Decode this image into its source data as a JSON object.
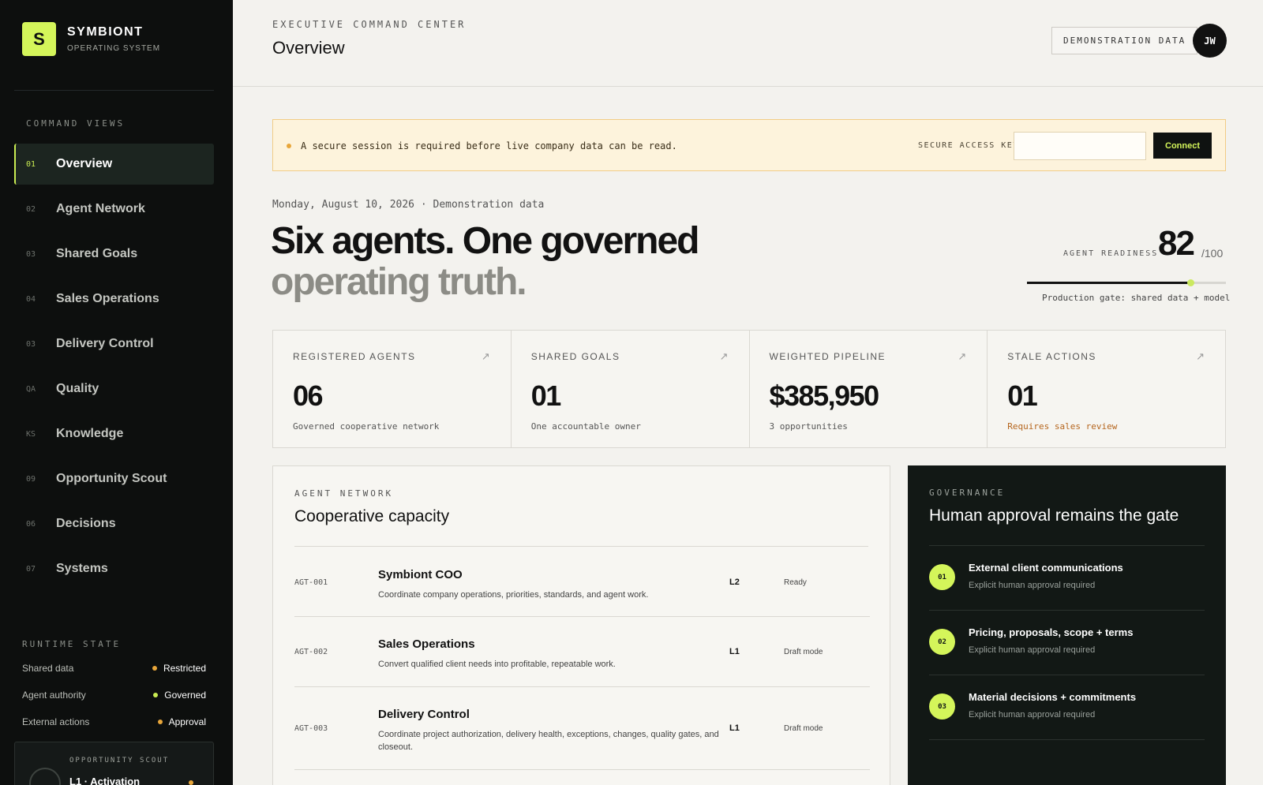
{
  "brand": {
    "logo_letter": "S",
    "name": "SYMBIONT",
    "subtitle": "OPERATING SYSTEM"
  },
  "sidebar": {
    "section_label": "COMMAND VIEWS",
    "items": [
      {
        "num": "01",
        "label": "Overview",
        "active": true
      },
      {
        "num": "02",
        "label": "Agent Network"
      },
      {
        "num": "03",
        "label": "Shared Goals"
      },
      {
        "num": "04",
        "label": "Sales Operations"
      },
      {
        "num": "03",
        "label": "Delivery Control"
      },
      {
        "num": "QA",
        "label": "Quality"
      },
      {
        "num": "KS",
        "label": "Knowledge"
      },
      {
        "num": "09",
        "label": "Opportunity Scout"
      },
      {
        "num": "06",
        "label": "Decisions"
      },
      {
        "num": "07",
        "label": "Systems"
      }
    ],
    "runtime_label": "RUNTIME STATE",
    "runtime": [
      {
        "label": "Shared data",
        "value": "Restricted",
        "color": "#e8a63a"
      },
      {
        "label": "Agent authority",
        "value": "Governed",
        "color": "#c9ec52"
      },
      {
        "label": "External actions",
        "value": "Approval",
        "color": "#e8a63a"
      }
    ],
    "scout": {
      "label": "OPPORTUNITY SCOUT",
      "title": "L1 · Activation"
    }
  },
  "header": {
    "eyebrow": "EXECUTIVE COMMAND CENTER",
    "title": "Overview",
    "demo_button": "DEMONSTRATION DATA",
    "avatar_initials": "JW"
  },
  "alert": {
    "message": "A secure session is required before live company data can be read.",
    "key_label": "SECURE ACCESS KEY",
    "key_value": "",
    "connect_label": "Connect"
  },
  "hero": {
    "dateline": "Monday, August 10, 2026 · Demonstration data",
    "line1": "Six agents. One governed",
    "line2": "operating truth.",
    "readiness_label": "AGENT READINESS",
    "readiness_score": "82",
    "readiness_max": "/100",
    "readiness_fraction": 0.82,
    "readiness_note": "Production gate: shared data + model"
  },
  "stats": [
    {
      "label": "REGISTERED AGENTS",
      "value": "06",
      "note": "Governed cooperative network",
      "warn": false
    },
    {
      "label": "SHARED GOALS",
      "value": "01",
      "note": "One accountable owner",
      "warn": false
    },
    {
      "label": "WEIGHTED PIPELINE",
      "value": "$385,950",
      "note": "3 opportunities",
      "warn": false
    },
    {
      "label": "STALE ACTIONS",
      "value": "01",
      "note": "Requires sales review",
      "warn": true
    }
  ],
  "agent_network": {
    "eyebrow": "AGENT NETWORK",
    "title": "Cooperative capacity",
    "agents": [
      {
        "id": "AGT-001",
        "name": "Symbiont COO",
        "desc": "Coordinate company operations, priorities, standards, and agent work.",
        "level": "L2",
        "status": "Ready"
      },
      {
        "id": "AGT-002",
        "name": "Sales Operations",
        "desc": "Convert qualified client needs into profitable, repeatable work.",
        "level": "L1",
        "status": "Draft mode"
      },
      {
        "id": "AGT-003",
        "name": "Delivery Control",
        "desc": "Coordinate project authorization, delivery health, exceptions, changes, quality gates, and closeout.",
        "level": "L1",
        "status": "Draft mode"
      }
    ]
  },
  "governance": {
    "eyebrow": "GOVERNANCE",
    "title": "Human approval remains the gate",
    "items": [
      {
        "num": "01",
        "title": "External client communications",
        "sub": "Explicit human approval required"
      },
      {
        "num": "02",
        "title": "Pricing, proposals, scope + terms",
        "sub": "Explicit human approval required"
      },
      {
        "num": "03",
        "title": "Material decisions + commitments",
        "sub": "Explicit human approval required"
      }
    ]
  },
  "colors": {
    "accent": "#d4f55a",
    "sidebar_bg": "#0d0f0e",
    "warn": "#e8a63a",
    "page_bg": "#f3f2ee"
  }
}
